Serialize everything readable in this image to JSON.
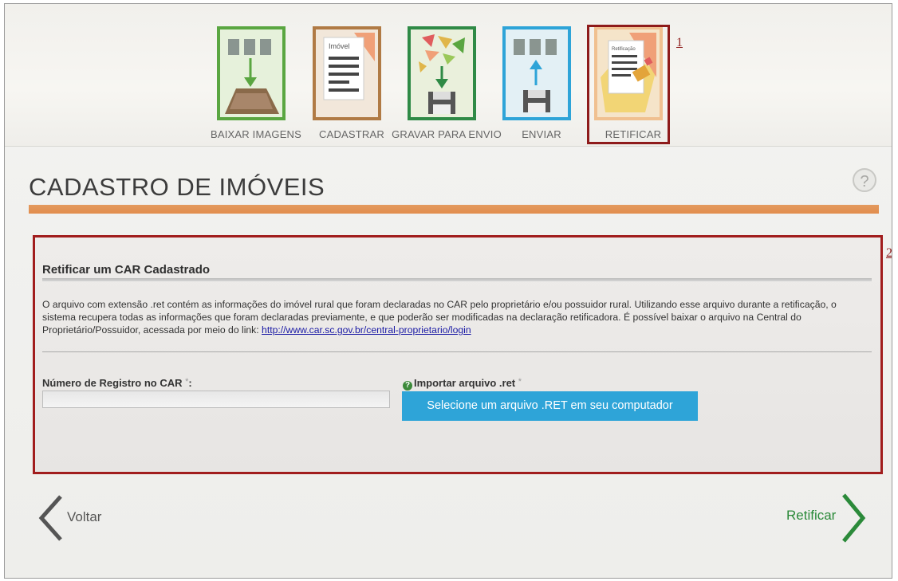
{
  "steps": [
    {
      "label": "BAIXAR IMAGENS",
      "color": "#5aa641"
    },
    {
      "label": "CADASTRAR",
      "color": "#b07a44",
      "tile_text": "Imóvel"
    },
    {
      "label": "GRAVAR PARA ENVIO",
      "color": "#2f8a46"
    },
    {
      "label": "ENVIAR",
      "color": "#2ea4d8"
    },
    {
      "label": "RETIFICAR",
      "color": "#e28d4d",
      "tile_text": "Retificação"
    }
  ],
  "annotations": {
    "one": "1",
    "two": "2"
  },
  "page": {
    "title": "CADASTRO DE IMÓVEIS",
    "help": "?"
  },
  "panel": {
    "title": "Retificar um CAR Cadastrado",
    "description": "O arquivo com extensão .ret contém as informações do imóvel rural que foram declaradas no CAR pelo proprietário e/ou possuidor rural. Utilizando esse arquivo durante a retificação, o sistema recupera todas as informações que foram declaradas previamente, e que poderão ser modificadas na declaração retificadora. É possível baixar o arquivo na Central do Proprietário/Possuidor, acessada por meio do link: ",
    "link": "http://www.car.sc.gov.br/central-proprietario/login",
    "registro_label": "Número de Registro no CAR",
    "registro_value": "",
    "required_mark": "*",
    "required_colon": ":",
    "import_label": "Importar arquivo .ret",
    "import_help_icon": "question-icon",
    "file_button": "Selecione um arquivo .RET em seu computador"
  },
  "nav": {
    "back": "Voltar",
    "next": "Retificar",
    "back_icon": "chevron-left-icon",
    "next_icon": "chevron-right-icon"
  },
  "colors": {
    "accent_orange": "#e28d4d",
    "highlight_red": "#a11d1d",
    "button_blue": "#2ea4d8",
    "next_green": "#2b8a3a"
  }
}
